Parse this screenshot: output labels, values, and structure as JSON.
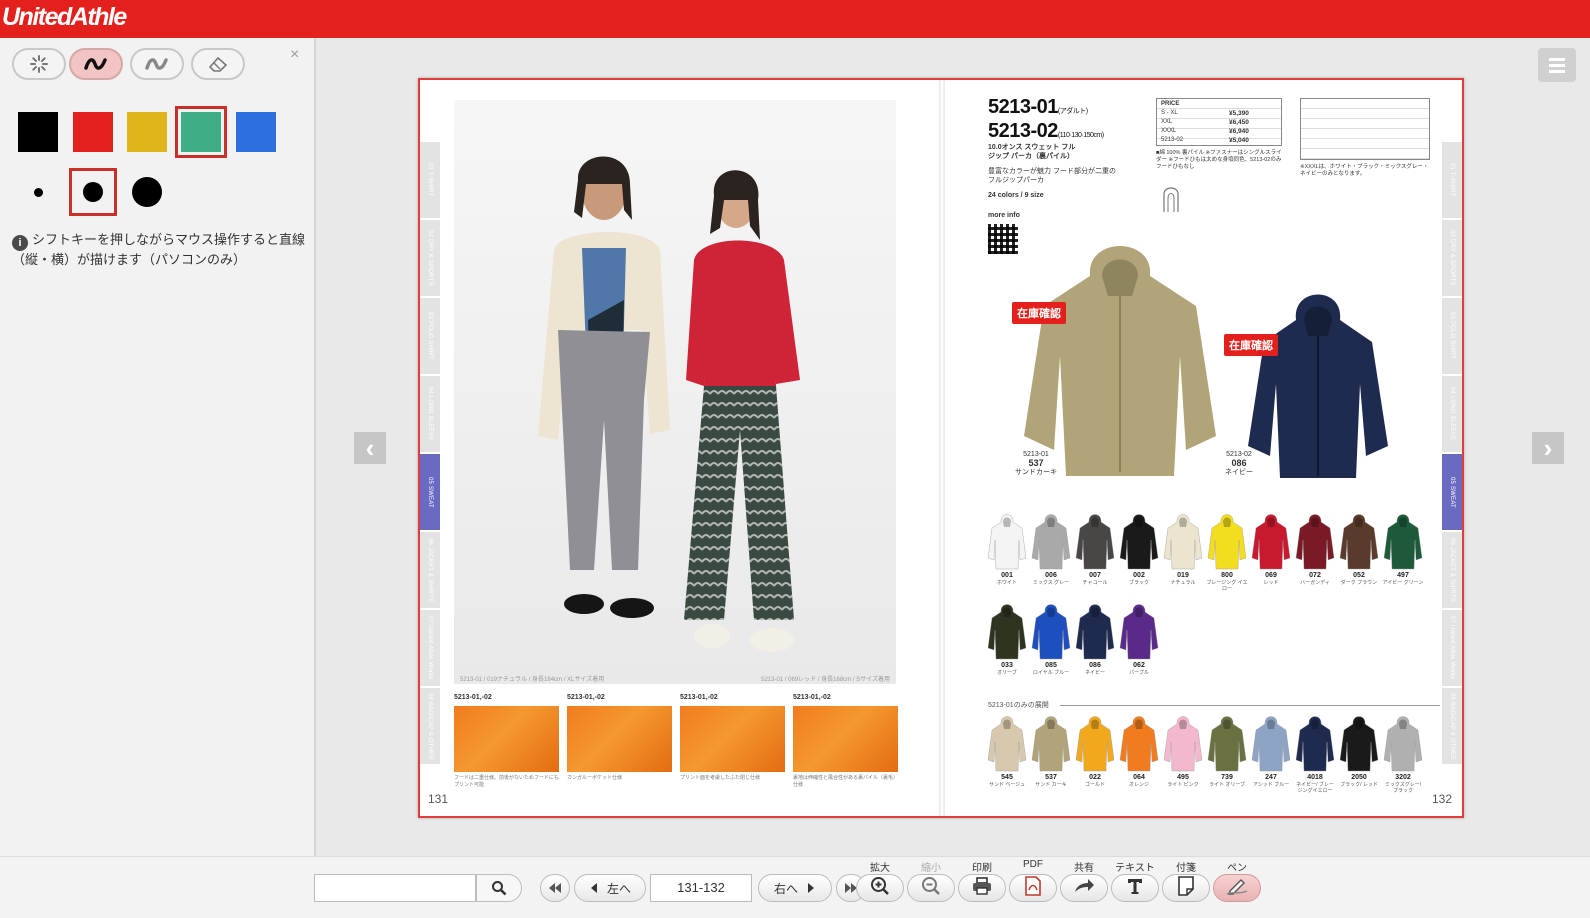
{
  "header": {
    "logo": "UnitedAthle"
  },
  "pen_panel": {
    "tools": [
      "spinner-icon",
      "pen-icon",
      "marker-icon",
      "eraser-icon"
    ],
    "active_tool": 1,
    "close": "×",
    "colors": [
      "#000000",
      "#e3201b",
      "#e0b51b",
      "#3fae85",
      "#2e6fe0"
    ],
    "selected_color": 3,
    "sizes": [
      "small",
      "medium",
      "large"
    ],
    "selected_size": 1,
    "info_text": "シフトキーを押しながらマウス操作すると直線（縦・横）が描けます（パソコンのみ）"
  },
  "viewer": {
    "prev_arrow": "‹",
    "next_arrow": "›",
    "side_tabs": [
      "01 T-SHIRT",
      "02 DRY & SPORTS",
      "03 POLO SHIRT",
      "04 LONG SLEEVE",
      "05 SWEAT",
      "06 JACKET & SHIRTS",
      "07 United Athle Works",
      "08 BAG/CAP & OTHER"
    ],
    "active_tab": 4,
    "left_page": {
      "caption_left": "5213-01 / 019ナチュラル / 身長184cm / XLサイズ着用",
      "caption_right": "5213-01 / 069レッド / 身長168cm / Sサイズ着用",
      "details": [
        {
          "title": "5213-01,-02",
          "text": "フードは二重仕様。前後がないためフードにもプリント可能"
        },
        {
          "title": "5213-01,-02",
          "text": "カンガルーポケット仕様"
        },
        {
          "title": "5213-01,-02",
          "text": "プリント面を考慮したふた閉じ仕様"
        },
        {
          "title": "5213-01,-02",
          "text": "裏地は伸縮性と風合性がある裏パイル（裏毛）仕様"
        }
      ],
      "page_number": "131"
    },
    "right_page": {
      "code1": "5213-01",
      "code1_note": "(アダルト)",
      "code2": "5213-02",
      "code2_note": "(110·130·150cm)",
      "product_name": "10.0オンス スウェット フルジップ パーカ（裏パイル）",
      "desc": "豊富なカラーが魅力 フード部分が二重のフルジップパーカ",
      "colors_size": "24 colors / 9 size",
      "more_info": "more info",
      "price_header": "PRICE",
      "prices": [
        {
          "size": "S - XL",
          "price": "¥5,390"
        },
        {
          "size": "XXL",
          "price": "¥6,450"
        },
        {
          "size": "XXXL",
          "price": "¥6,940"
        },
        {
          "size": "5213-02",
          "price": "¥5,040"
        }
      ],
      "material": "■綿 100% 裏パイル ※ファスナーはシングルスライダー ※フードひもは太めな身頃同色、5213-02のみフードひもなし",
      "size_note": "※XXXLは、ホワイト・ブラック・ミックスグレー・ネイビーのみとなります。",
      "stock_label": "在庫確認",
      "featured": [
        {
          "code": "5213-01",
          "num": "537",
          "name": "サンドカーキ",
          "color": "#b1a478"
        },
        {
          "code": "5213-02",
          "num": "086",
          "name": "ネイビー",
          "color": "#1f2a4f"
        }
      ],
      "swatches": [
        {
          "num": "001",
          "name": "ホワイト",
          "color": "#f4f4f4"
        },
        {
          "num": "006",
          "name": "ミックス グレー",
          "color": "#a9a9a9"
        },
        {
          "num": "007",
          "name": "チャコール",
          "color": "#4a4646"
        },
        {
          "num": "002",
          "name": "ブラック",
          "color": "#1a1a1a"
        },
        {
          "num": "019",
          "name": "ナチュラル",
          "color": "#ece4cf"
        },
        {
          "num": "800",
          "name": "ブレージング イエロー",
          "color": "#f2dd1e"
        },
        {
          "num": "069",
          "name": "レッド",
          "color": "#c8192e"
        },
        {
          "num": "072",
          "name": "バーガンディ",
          "color": "#7a1a26"
        },
        {
          "num": "052",
          "name": "ダーク ブラウン",
          "color": "#5a3a2a"
        },
        {
          "num": "497",
          "name": "アイビー グリーン",
          "color": "#1d5a3a"
        },
        {
          "num": "033",
          "name": "オリーブ",
          "color": "#2d3420"
        },
        {
          "num": "085",
          "name": "ロイヤル ブルー",
          "color": "#1d4fbf"
        },
        {
          "num": "086",
          "name": "ネイビー",
          "color": "#1f2a4f"
        },
        {
          "num": "062",
          "name": "パープル",
          "color": "#5a2a8a"
        }
      ],
      "section_label": "5213-01のみの展開",
      "extra_swatches": [
        {
          "num": "545",
          "name": "サンド ベージュ",
          "color": "#d8c8ad"
        },
        {
          "num": "537",
          "name": "サンド カーキ",
          "color": "#b1a478"
        },
        {
          "num": "022",
          "name": "ゴールド",
          "color": "#f2a81c"
        },
        {
          "num": "064",
          "name": "オレンジ",
          "color": "#f07c1f"
        },
        {
          "num": "495",
          "name": "ライト ピンク",
          "color": "#f3b8cf"
        },
        {
          "num": "739",
          "name": "ライト オリーブ",
          "color": "#6a7040"
        },
        {
          "num": "247",
          "name": "アシッド ブルー",
          "color": "#8ea4c4"
        },
        {
          "num": "4018",
          "name": "ネイビー/ ブレージングイエロー",
          "color": "#1f2a4f"
        },
        {
          "num": "2050",
          "name": "ブラック/ レッド",
          "color": "#1a1a1a"
        },
        {
          "num": "3202",
          "name": "ミックスグレー/ ブラック",
          "color": "#b0b0b0"
        }
      ],
      "page_number": "132"
    }
  },
  "toolbar": {
    "search_placeholder": "",
    "first_icon": "first-page-icon",
    "prev_label": "左へ",
    "page_value": "131-132",
    "next_label": "右へ",
    "last_icon": "last-page-icon",
    "buttons": [
      {
        "label": "拡大",
        "icon": "zoom-in-icon"
      },
      {
        "label": "縮小",
        "icon": "zoom-out-icon"
      },
      {
        "label": "印刷",
        "icon": "print-icon"
      },
      {
        "label": "PDF",
        "icon": "pdf-icon"
      },
      {
        "label": "共有",
        "icon": "share-icon"
      },
      {
        "label": "テキスト",
        "icon": "text-icon"
      },
      {
        "label": "付箋",
        "icon": "sticky-note-icon"
      },
      {
        "label": "ペン",
        "icon": "pen-icon"
      }
    ]
  }
}
